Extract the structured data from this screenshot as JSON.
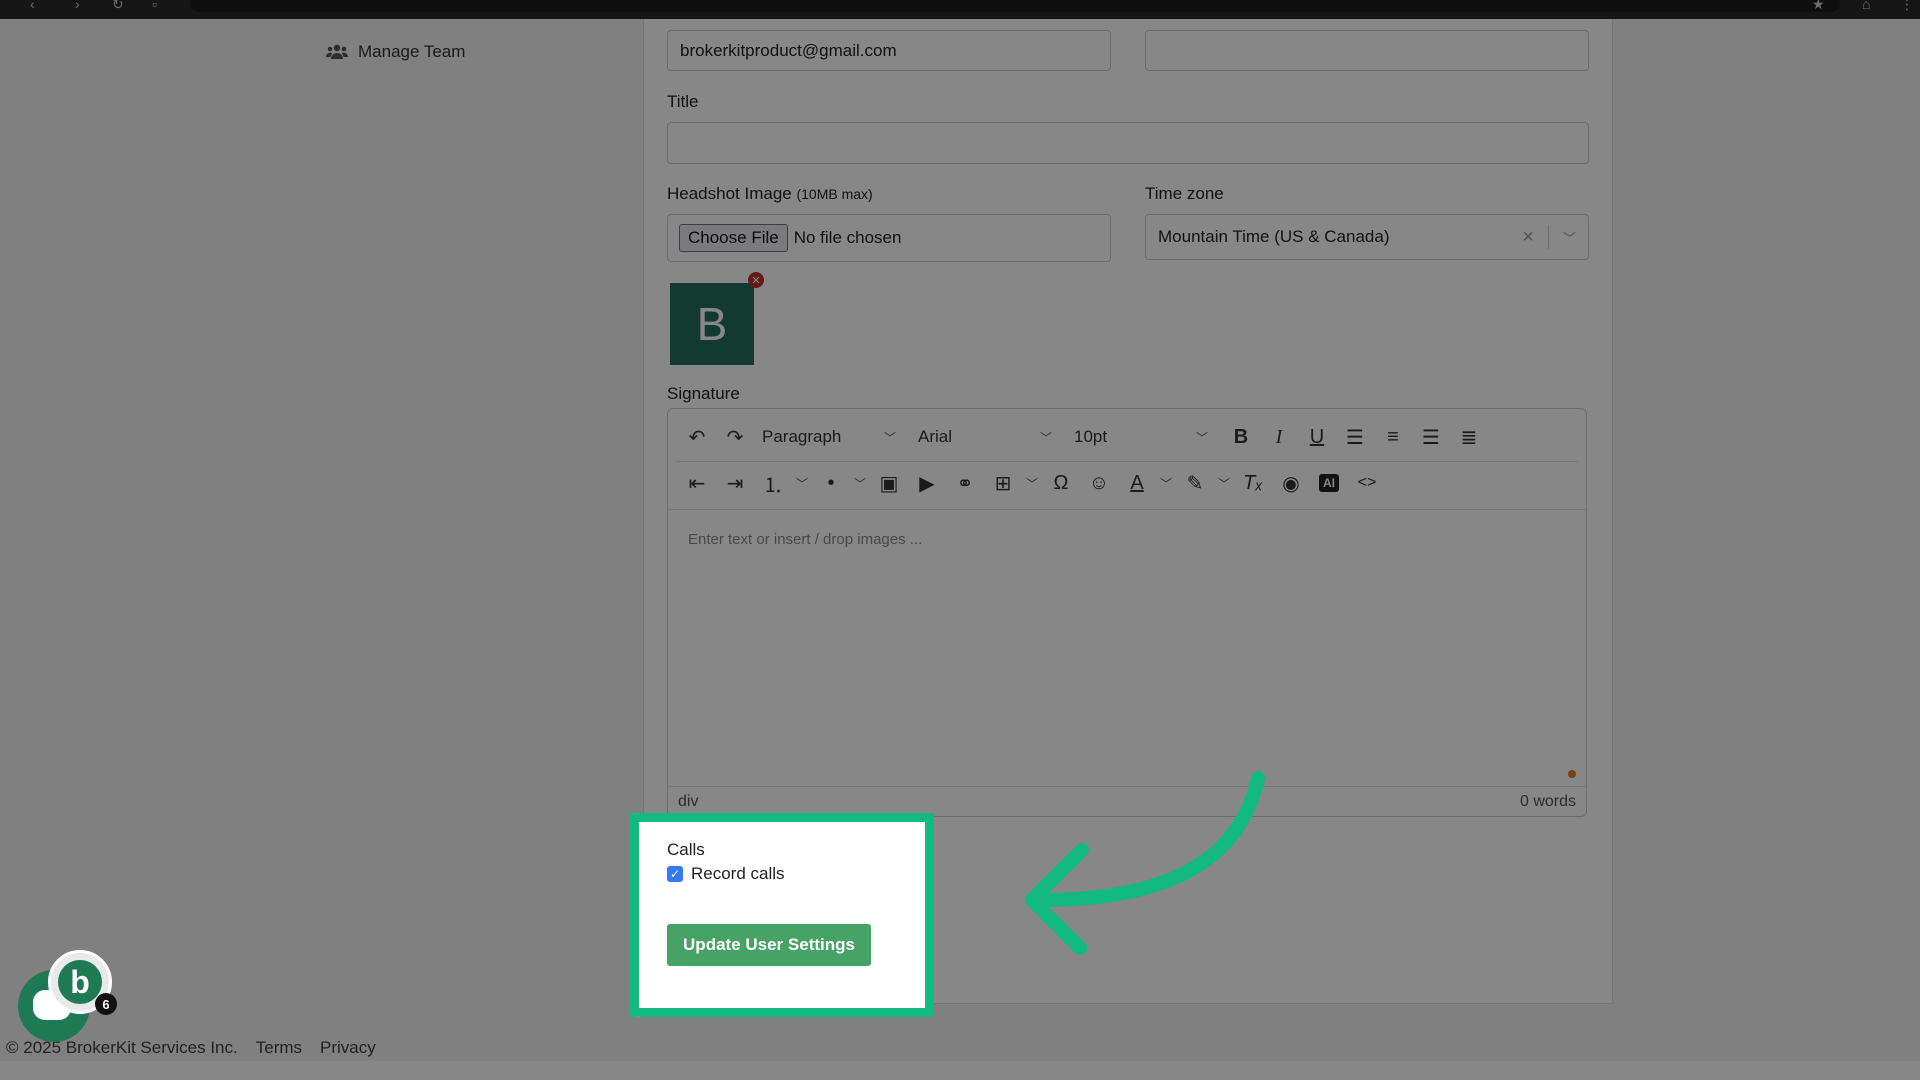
{
  "sidebar": {
    "manage_team": "Manage Team"
  },
  "form": {
    "email_value": "brokerkitproduct@gmail.com",
    "title_label": "Title",
    "headshot_label": "Headshot Image",
    "headshot_hint": "(10MB max)",
    "choose_file": "Choose File",
    "no_file": "No file chosen",
    "timezone_label": "Time zone",
    "timezone_value": "Mountain Time (US & Canada)",
    "avatar_letter": "B",
    "signature_label": "Signature"
  },
  "editor": {
    "block_format": "Paragraph",
    "font_family": "Arial",
    "font_size": "10pt",
    "ai_label": "AI",
    "placeholder": "Enter text or insert / drop images ...",
    "status_path": "div",
    "word_count": "0 words"
  },
  "calls": {
    "label": "Calls",
    "record_label": "Record calls",
    "record_checked": true,
    "update_button": "Update User Settings"
  },
  "footer": {
    "copyright": "© 2025 BrokerKit Services Inc.",
    "terms": "Terms",
    "privacy": "Privacy"
  },
  "chat": {
    "brand_letter": "b",
    "count": "6"
  },
  "colors": {
    "highlight": "#12b981",
    "button": "#47a266",
    "avatar": "#236e5c"
  }
}
